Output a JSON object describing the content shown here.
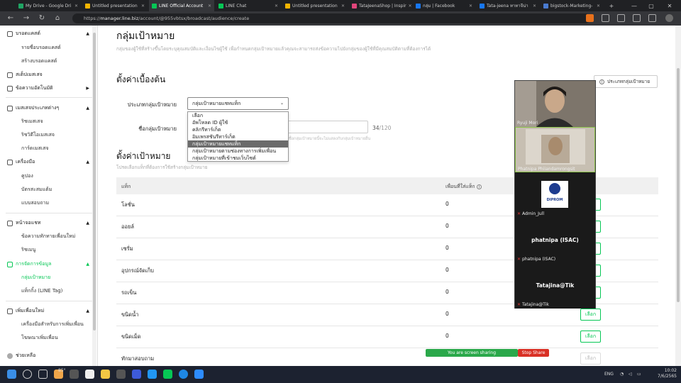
{
  "browser": {
    "tabs": [
      {
        "title": "My Drive - Google Dri",
        "color": "#1fa463"
      },
      {
        "title": "Untitled presentation",
        "color": "#f4b400"
      },
      {
        "title": "LINE Official Account",
        "color": "#06c755"
      },
      {
        "title": "LINE Chat",
        "color": "#06c755"
      },
      {
        "title": "Untitled presentation",
        "color": "#f4b400"
      },
      {
        "title": "TataJeenaShop | Inspir",
        "color": "#e0457b"
      },
      {
        "title": "กลุ่ม | Facebook",
        "color": "#1877f2"
      },
      {
        "title": "Tata-jeena ทาทาจีน่า",
        "color": "#1877f2"
      },
      {
        "title": "bigstock-Marketing-",
        "color": "#4a7bd0"
      }
    ],
    "url_host": "manager.line.biz",
    "url_path": "/account/@955vbtsx/broadcast/audience/create",
    "url_prefix": "https://"
  },
  "sidebar": {
    "sections": [
      {
        "label": "บรอดแคสต์",
        "icon": "megaphone-icon"
      },
      {
        "label": "สเต็ปเมสเสจ",
        "icon": "steps-icon"
      },
      {
        "label": "ข้อความอัตโนมัติ",
        "icon": "auto-reply-icon"
      },
      {
        "label": "เมสเสจประเภทต่างๆ",
        "icon": "message-types-icon"
      },
      {
        "label": "เครื่องมือ",
        "icon": "tools-icon"
      },
      {
        "label": "หน้าจอแชท",
        "icon": "chat-screen-icon"
      },
      {
        "label": "การจัดการข้อมูล",
        "icon": "data-management-icon"
      },
      {
        "label": "เพิ่มเพื่อนใหม่",
        "icon": "add-friend-icon"
      }
    ],
    "items": {
      "broadcast_list": "รายชื่อบรอดแคสต์",
      "create_broadcast": "สร้างบรอดแคสต์",
      "rich_message": "ริชเมสเสจ",
      "rich_video": "ริชวิดีโอเมสเสจ",
      "card_message": "การ์ดเมสเสจ",
      "coupon": "คูปอง",
      "reward_card": "บัตรสะสมแต้ม",
      "survey": "แบบสอบถาม",
      "greeting": "ข้อความทักทายเพื่อนใหม่",
      "rich_menu": "ริชเมนู",
      "audience": "กลุ่มเป้าหมาย",
      "tag": "แท็กกิ้ง (LINE Tag)",
      "friend_tools": "เครื่องมือสำหรับการเพิ่มเพื่อน",
      "friend_ads": "โฆษณาเพิ่มเพื่อน"
    },
    "help": "ช่วยเหลือ"
  },
  "main": {
    "title": "กลุ่มเป้าหมาย",
    "description": "กลุ่มของผู้ใช้ที่สร้างขึ้นโดยระบุคุณสมบัติและเงื่อนไขผู้ใช้ เพื่อกำหนดกลุ่มเป้าหมายแล้วคุณจะสามารถส่งข้อความไปยังกลุ่มของผู้ใช้ที่มีคุณสมบัติตามที่ต้องการได้",
    "help_button": "ประเภทกลุ่มเป้าหมาย",
    "basic_settings": {
      "title": "ตั้งค่าเบื้องต้น",
      "type_label": "ประเภทกลุ่มเป้าหมาย",
      "type_value": "กลุ่มเป้าหมายแชทแท็ก",
      "dropdown_options": [
        "เลือก",
        "อัพโหลด ID ผู้ใช้",
        "คลิกรีทาร์เก็ต",
        "อิมเพรสชันรีทาร์เก็ต",
        "กลุ่มเป้าหมายแชทแท็ก",
        "กลุ่มเป้าหมายตามช่องทางการเพิ่มเพื่อน",
        "กลุ่มเป้าหมายที่เข้าชมเว็บไซต์"
      ],
      "selected_option_index": 4,
      "name_label": "ชื่อกลุ่มเป้าหมาย",
      "name_value": "",
      "name_count": "34",
      "name_max": "/120",
      "name_hint": "ชื่อกลุ่มเป้าหมายนี้จะไม่แสดงกับกลุ่มเป้าหมายอื่น"
    },
    "target_settings": {
      "title": "ตั้งค่าเป้าหมาย",
      "subtitle": "โปรดเลือกแท็กที่ต้องการใช้สร้างกลุ่มเป้าหมาย",
      "col_tag": "แท็ก",
      "col_friends": "เพื่อนที่ใส่แท็ก",
      "rows": [
        {
          "tag": "โลชั่น",
          "count": "0",
          "action": "เลือก",
          "enabled": true
        },
        {
          "tag": "ออยล์",
          "count": "0",
          "action": "เลือก",
          "enabled": true
        },
        {
          "tag": "เซรั่ม",
          "count": "0",
          "action": "เลือก",
          "enabled": true
        },
        {
          "tag": "อุปกรณ์จัดเก็บ",
          "count": "0",
          "action": "เลือก",
          "enabled": true
        },
        {
          "tag": "รถเข็น",
          "count": "0",
          "action": "เลือก",
          "enabled": true
        },
        {
          "tag": "ขนิดน้ำ",
          "count": "0",
          "action": "เลือก",
          "enabled": true
        },
        {
          "tag": "ขนิดเม็ด",
          "count": "0",
          "action": "เลือก",
          "enabled": true
        },
        {
          "tag": "ทักมาสอบถาม",
          "count": "",
          "action": "เลือก",
          "enabled": false
        }
      ]
    }
  },
  "zoom": {
    "participants": [
      {
        "name": "Ryuji Mori"
      },
      {
        "name": "Phatnipa Phiiandamrongsit"
      },
      {
        "name": "Admin_Jull",
        "logo_text": "DIPROM"
      },
      {
        "name": "phatnipa (ISAC)",
        "big": "phatnipa (ISAC)"
      },
      {
        "name": "Tatajina@Tik",
        "big": "Tatajina@Tik"
      }
    ],
    "share_status": "You are screen sharing",
    "stop_share": "Stop Share"
  },
  "taskbar": {
    "weather": "85°",
    "lang": "ENG",
    "time": "10:02",
    "date": "7/6/2565"
  }
}
